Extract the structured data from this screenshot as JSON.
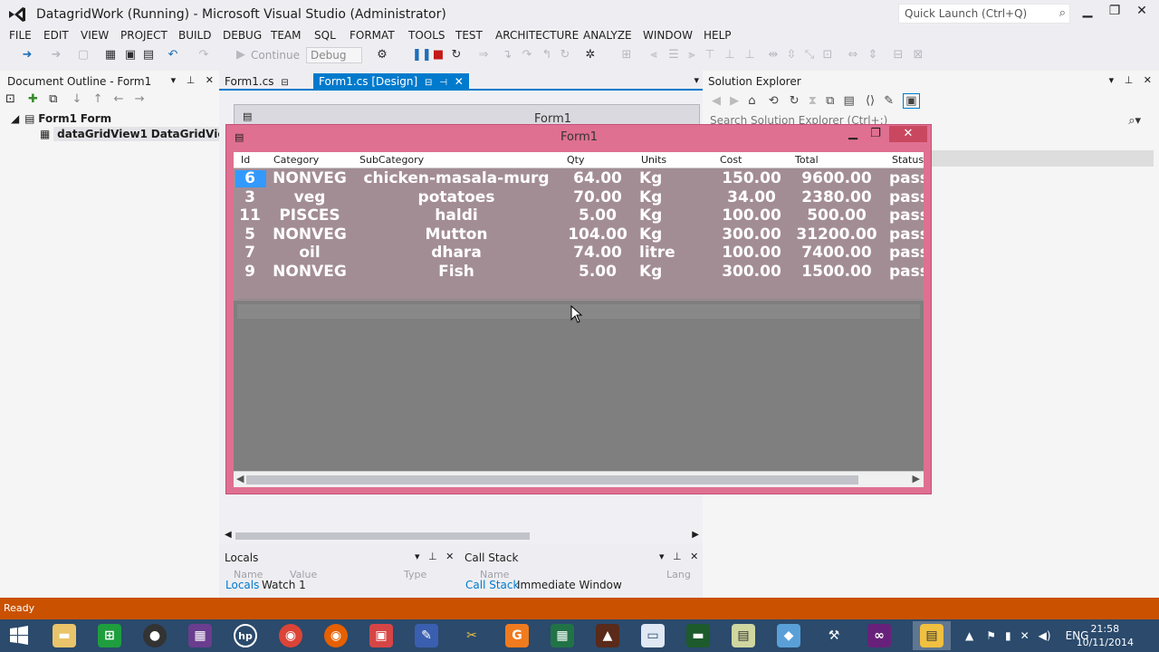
{
  "app": {
    "title": "DatagridWork (Running) - Microsoft Visual Studio (Administrator)",
    "quick_launch_placeholder": "Quick Launch (Ctrl+Q)"
  },
  "menu": [
    "FILE",
    "EDIT",
    "VIEW",
    "PROJECT",
    "BUILD",
    "DEBUG",
    "TEAM",
    "SQL",
    "FORMAT",
    "TOOLS",
    "TEST",
    "ARCHITECTURE",
    "ANALYZE",
    "WINDOW",
    "HELP"
  ],
  "toolbar": {
    "continue_label": "Continue",
    "config_value": "Debug"
  },
  "document_outline": {
    "title": "Document Outline - Form1",
    "tree": [
      {
        "name": "Form1",
        "type": "Form"
      },
      {
        "name": "dataGridView1",
        "type": "DataGridView"
      }
    ]
  },
  "doc_tabs": [
    {
      "label": "Form1.cs",
      "active": false
    },
    {
      "label": "Form1.cs [Design]",
      "active": true
    }
  ],
  "designer": {
    "form_title": "Form1"
  },
  "solution_explorer": {
    "title": "Solution Explorer",
    "search_placeholder": "Search Solution Explorer (Ctrl+;)"
  },
  "running_form": {
    "title": "Form1",
    "grid": {
      "columns": [
        "Id",
        "Category",
        "SubCategory",
        "Qty",
        "Units",
        "Cost",
        "Total",
        "Status"
      ],
      "rows": [
        [
          "6",
          "NONVEG",
          "chicken-masala-murg",
          "64.00",
          "Kg",
          "150.00",
          "9600.00",
          "pass"
        ],
        [
          "3",
          "veg",
          "potatoes",
          "70.00",
          "Kg",
          "34.00",
          "2380.00",
          "pass"
        ],
        [
          "11",
          "PISCES",
          "haldi",
          "5.00",
          "Kg",
          "100.00",
          "500.00",
          "pass"
        ],
        [
          "5",
          "NONVEG",
          "Mutton",
          "104.00",
          "Kg",
          "300.00",
          "31200.00",
          "pass"
        ],
        [
          "7",
          "oil",
          "dhara",
          "74.00",
          "litre",
          "100.00",
          "7400.00",
          "pass"
        ],
        [
          "9",
          "NONVEG",
          "Fish",
          "5.00",
          "Kg",
          "300.00",
          "1500.00",
          "pass"
        ]
      ]
    }
  },
  "bottom_panels": {
    "locals": {
      "title": "Locals",
      "col_name": "Name",
      "col_value": "Value",
      "col_type": "Type"
    },
    "call_stack": {
      "title": "Call Stack",
      "col_name": "Name",
      "col_lang": "Lang"
    },
    "left_tabs": [
      "Locals",
      "Watch 1"
    ],
    "right_tabs": [
      "Call Stack",
      "Immediate Window"
    ]
  },
  "status": {
    "text": "Ready"
  },
  "taskbar": {
    "lang": "ENG",
    "time": "21:58",
    "date": "10/11/2014"
  },
  "colors": {
    "accent": "#007acc",
    "status_bar": "#ca5100",
    "form_border": "#df7092",
    "taskbar": "#2b4a6c"
  }
}
